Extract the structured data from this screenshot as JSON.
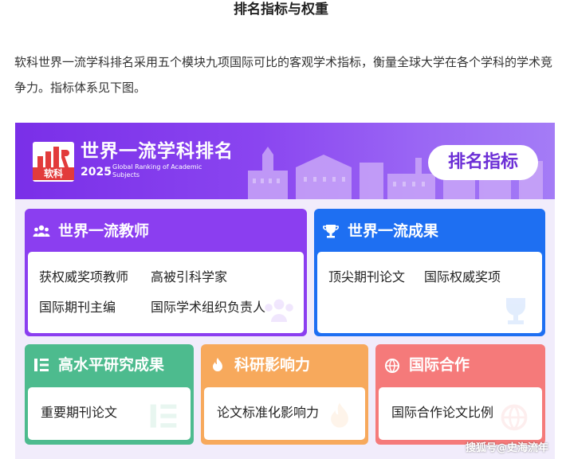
{
  "heading": "排名指标与权重",
  "intro": "软科世界一流学科排名采用五个模块九项国际可比的客观学术指标，衡量全球大学在各个学科的学术竞争力。指标体系见下图。",
  "banner": {
    "logo_text": "软科",
    "brand_cn": "世界一流学科排名",
    "brand_year": "2025",
    "brand_en": "Global Ranking of Academic Subjects",
    "pill": "排名指标"
  },
  "cards": {
    "faculty": {
      "title": "世界一流教师",
      "icon": "people-icon",
      "color": "#8b3ef0",
      "items": [
        "获权威奖项教师",
        "高被引科学家",
        "国际期刊主编",
        "国际学术组织负责人"
      ]
    },
    "output": {
      "title": "世界一流成果",
      "icon": "trophy-icon",
      "color": "#1e6ff2",
      "items": [
        "顶尖期刊论文",
        "国际权威奖项"
      ]
    },
    "research": {
      "title": "高水平研究成果",
      "icon": "list-icon",
      "color": "#4dbb8e",
      "items": [
        "重要期刊论文"
      ]
    },
    "impact": {
      "title": "科研影响力",
      "icon": "flame-icon",
      "color": "#f7a95c",
      "items": [
        "论文标准化影响力"
      ]
    },
    "intl": {
      "title": "国际合作",
      "icon": "globe-icon",
      "color": "#f57a7a",
      "items": [
        "国际合作论文比例"
      ]
    }
  },
  "watermark": "搜狐号@史海流年"
}
